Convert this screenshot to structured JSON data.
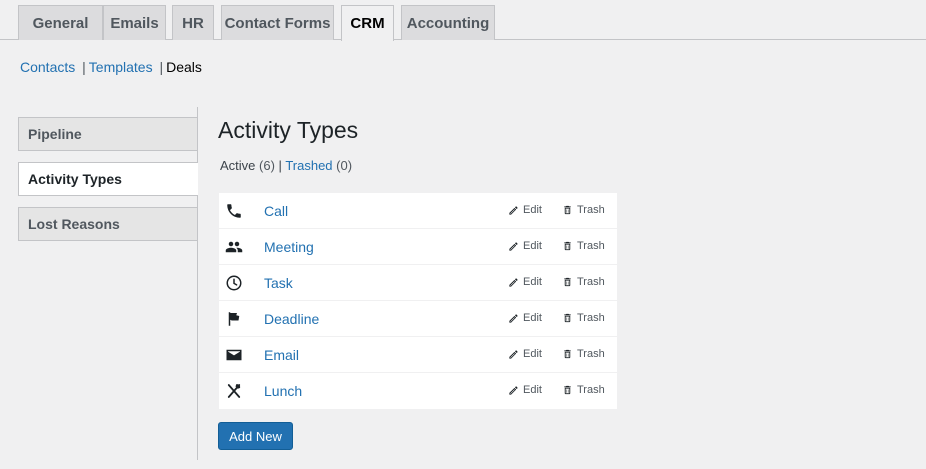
{
  "tabs": [
    {
      "label": "General"
    },
    {
      "label": "Emails"
    },
    {
      "label": "HR"
    },
    {
      "label": "Contact Forms"
    },
    {
      "label": "CRM",
      "active": true
    },
    {
      "label": "Accounting"
    }
  ],
  "subnav": {
    "contacts": "Contacts",
    "templates": "Templates",
    "deals": "Deals",
    "separator": "|"
  },
  "sidemenu": {
    "items": [
      {
        "label": "Pipeline"
      },
      {
        "label": "Activity Types",
        "active": true
      },
      {
        "label": "Lost Reasons"
      }
    ]
  },
  "main": {
    "title": "Activity Types",
    "filters": {
      "active_label": "Active",
      "active_count": "(6)",
      "separator": "|",
      "trashed_label": "Trashed",
      "trashed_count": "(0)"
    },
    "edit_label": "Edit",
    "trash_label": "Trash",
    "activities": [
      {
        "name": "Call",
        "icon": "phone-icon"
      },
      {
        "name": "Meeting",
        "icon": "people-icon"
      },
      {
        "name": "Task",
        "icon": "clock-icon"
      },
      {
        "name": "Deadline",
        "icon": "flag-icon"
      },
      {
        "name": "Email",
        "icon": "envelope-icon"
      },
      {
        "name": "Lunch",
        "icon": "utensils-icon"
      }
    ],
    "add_new_label": "Add New"
  },
  "colors": {
    "accent": "#2271b1",
    "background": "#f0f0f1",
    "panel": "#ffffff"
  }
}
